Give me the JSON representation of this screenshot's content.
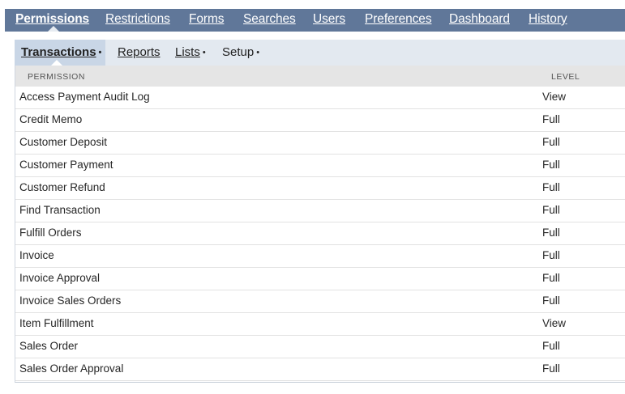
{
  "main_tabs": [
    {
      "label": "Permissions",
      "active": true
    },
    {
      "label": "Restrictions",
      "active": false
    },
    {
      "label": "Forms",
      "active": false
    },
    {
      "label": "Searches",
      "active": false
    },
    {
      "label": "Users",
      "active": false
    },
    {
      "label": "Preferences",
      "active": false
    },
    {
      "label": "Dashboard",
      "active": false
    },
    {
      "label": "History",
      "active": false
    }
  ],
  "sub_tabs": [
    {
      "label": "Transactions",
      "active": true,
      "dot": "•"
    },
    {
      "label": "Reports",
      "active": false,
      "dot": ""
    },
    {
      "label": "Lists",
      "active": false,
      "dot": "•"
    },
    {
      "label": "Setup",
      "active": false,
      "dot": "•"
    }
  ],
  "table": {
    "headers": {
      "permission": "PERMISSION",
      "level": "LEVEL"
    },
    "rows": [
      {
        "permission": "Access Payment Audit Log",
        "level": "View"
      },
      {
        "permission": "Credit Memo",
        "level": "Full"
      },
      {
        "permission": "Customer Deposit",
        "level": "Full"
      },
      {
        "permission": "Customer Payment",
        "level": "Full"
      },
      {
        "permission": "Customer Refund",
        "level": "Full"
      },
      {
        "permission": "Find Transaction",
        "level": "Full"
      },
      {
        "permission": "Fulfill Orders",
        "level": "Full"
      },
      {
        "permission": "Invoice",
        "level": "Full"
      },
      {
        "permission": "Invoice Approval",
        "level": "Full"
      },
      {
        "permission": "Invoice Sales Orders",
        "level": "Full"
      },
      {
        "permission": "Item Fulfillment",
        "level": "View"
      },
      {
        "permission": "Sales Order",
        "level": "Full"
      },
      {
        "permission": "Sales Order Approval",
        "level": "Full"
      }
    ]
  },
  "colors": {
    "tabbar": "#607799",
    "subbar": "#e3e9f0",
    "subbar_active": "#c9d6e6",
    "header_bg": "#e5e5e5"
  }
}
